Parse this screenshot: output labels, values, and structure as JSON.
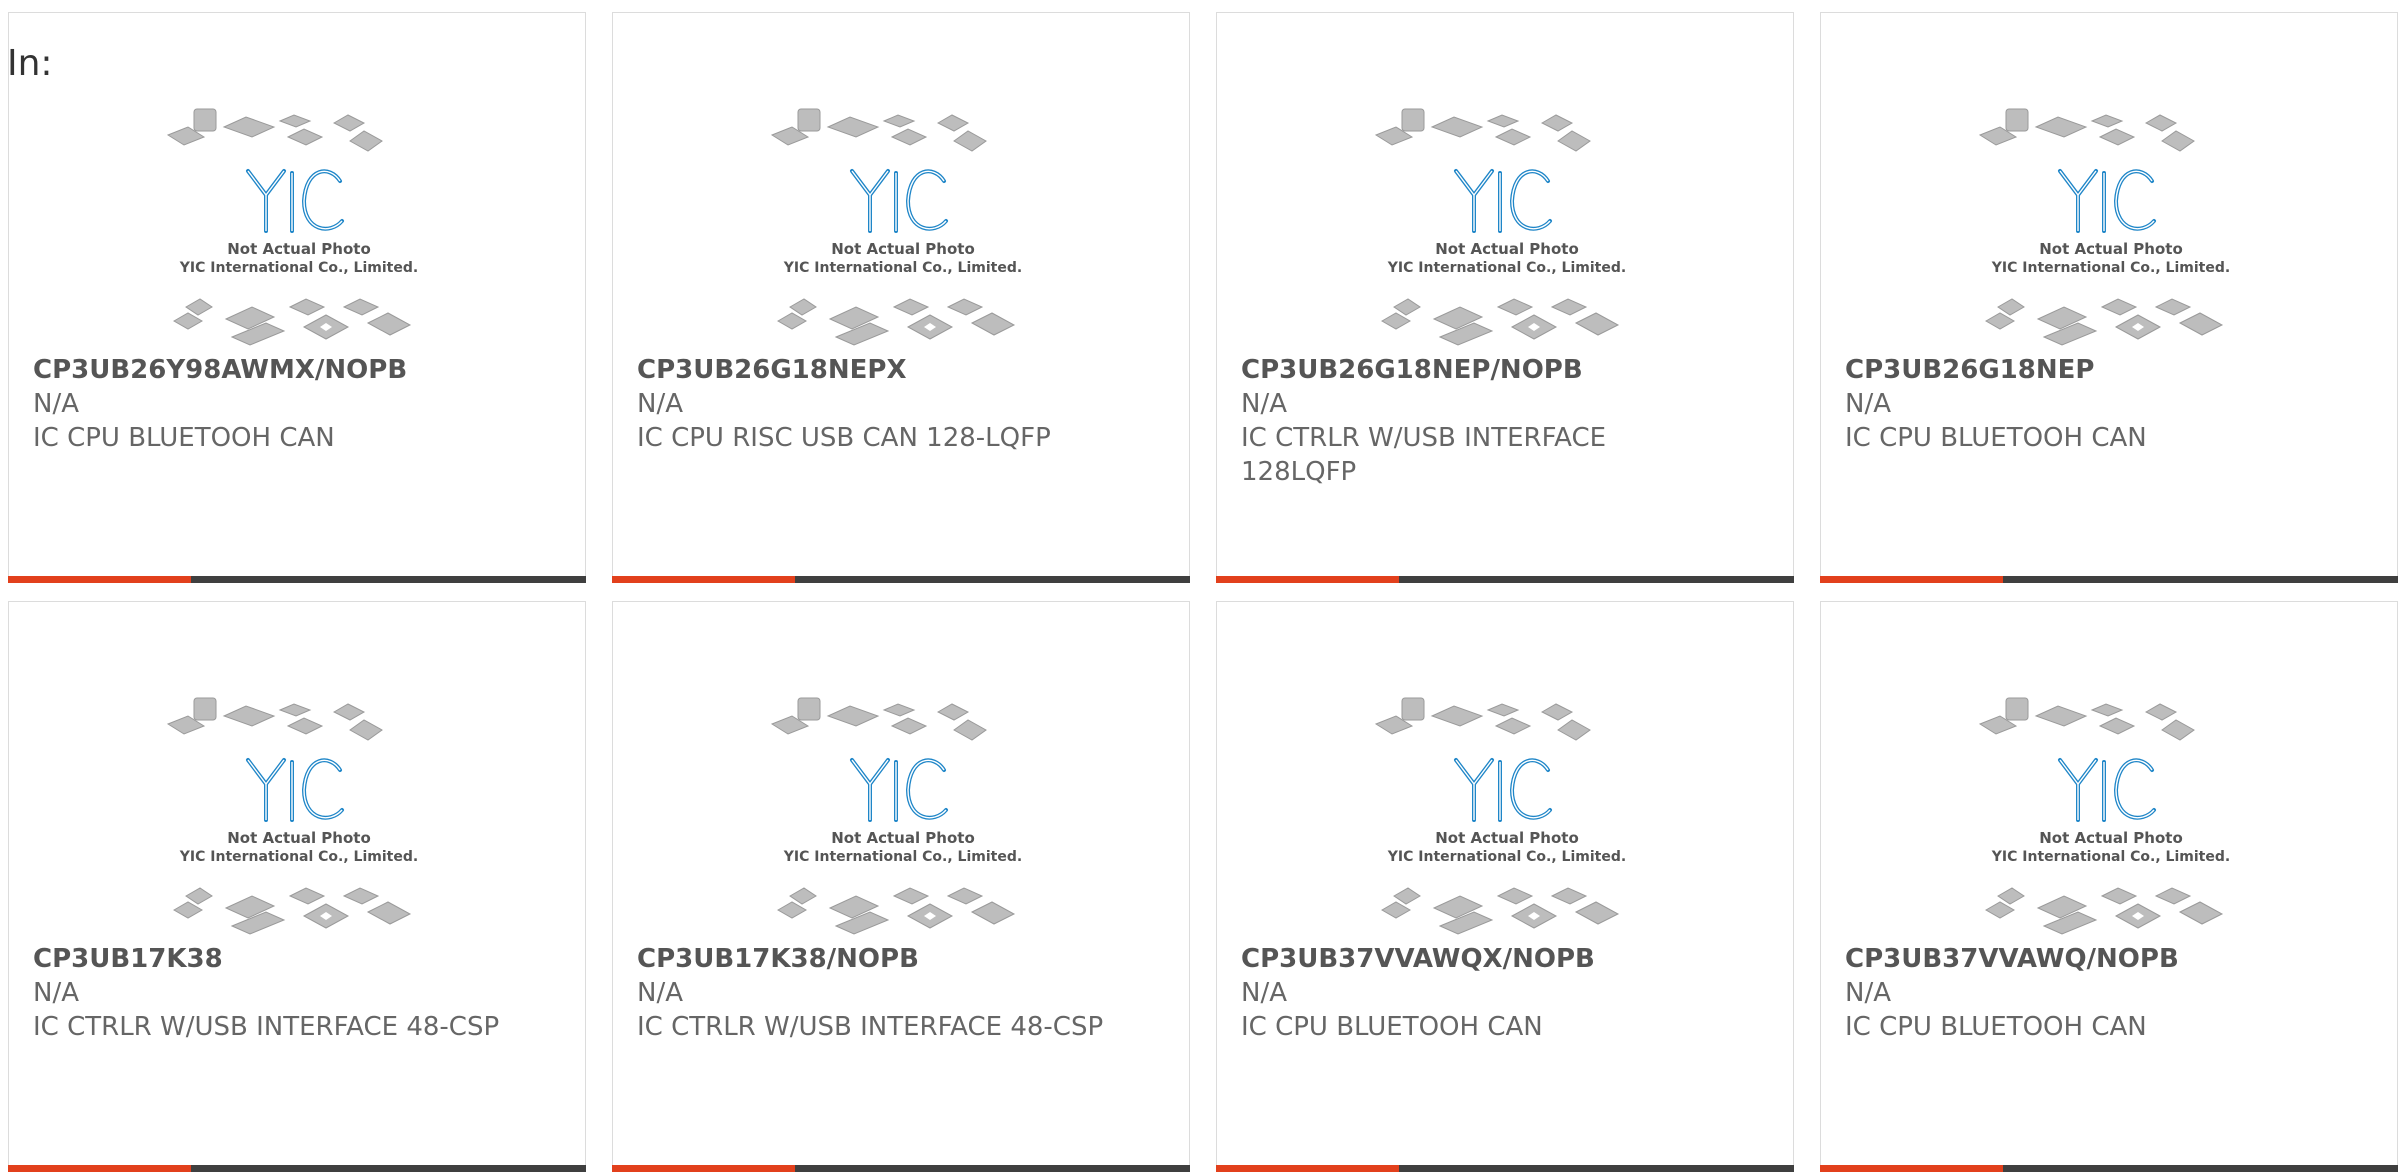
{
  "filter": {
    "label": "In:"
  },
  "placeholder_image": {
    "icon": "yic-logo-placeholder-icon",
    "logo_text": "YIC",
    "caption_line1": "Not Actual Photo",
    "caption_line2": "YIC International Co., Limited.",
    "logo_color": "#1f86c8"
  },
  "colors": {
    "accent": "#e2401c",
    "bar_dark": "#3f3f3f",
    "text": "#555555",
    "card_border": "#dcdcdc"
  },
  "products": [
    {
      "part_number": "CP3UB26Y98AWMX/NOPB",
      "manufacturer": "N/A",
      "description": "IC CPU BLUETOOH CAN"
    },
    {
      "part_number": "CP3UB26G18NEPX",
      "manufacturer": "N/A",
      "description": "IC CPU RISC USB CAN 128-LQFP"
    },
    {
      "part_number": "CP3UB26G18NEP/NOPB",
      "manufacturer": "N/A",
      "description": "IC CTRLR W/USB INTERFACE 128LQFP"
    },
    {
      "part_number": "CP3UB26G18NEP",
      "manufacturer": "N/A",
      "description": "IC CPU BLUETOOH CAN"
    },
    {
      "part_number": "CP3UB17K38",
      "manufacturer": "N/A",
      "description": "IC CTRLR W/USB INTERFACE 48-CSP"
    },
    {
      "part_number": "CP3UB17K38/NOPB",
      "manufacturer": "N/A",
      "description": "IC CTRLR W/USB INTERFACE 48-CSP"
    },
    {
      "part_number": "CP3UB37VVAWQX/NOPB",
      "manufacturer": "N/A",
      "description": "IC CPU BLUETOOH CAN"
    },
    {
      "part_number": "CP3UB37VVAWQ/NOPB",
      "manufacturer": "N/A",
      "description": "IC CPU BLUETOOH CAN"
    }
  ]
}
